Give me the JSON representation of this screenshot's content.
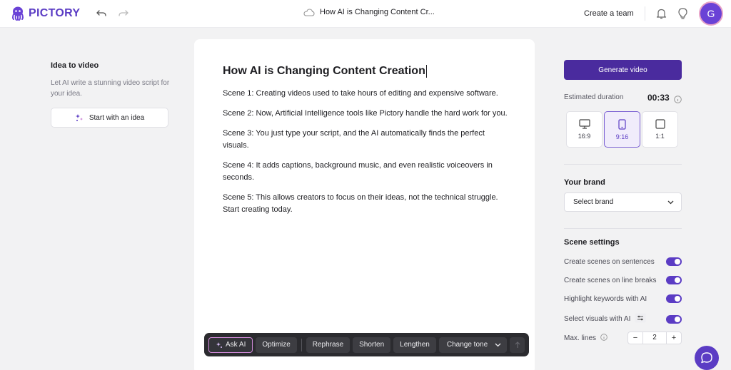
{
  "brand": {
    "name": "PICTORY",
    "accent": "#5b3cc4"
  },
  "header": {
    "doc_title": "How AI is Changing Content Cr...",
    "create_team": "Create a team",
    "avatar_initial": "G"
  },
  "left_panel": {
    "title": "Idea to video",
    "description": "Let AI write a stunning video script for your idea.",
    "start_button": "Start with an idea"
  },
  "editor": {
    "title": "How AI is Changing Content Creation",
    "scenes": [
      "Scene 1: Creating videos used to take hours of editing and expensive software.",
      "Scene 2: Now, Artificial Intelligence tools like Pictory handle the hard work for you.",
      "Scene 3: You just type your script, and the AI automatically finds the perfect visuals.",
      "Scene 4: It adds captions, background music, and even realistic voiceovers in seconds.",
      "Scene 5: This allows creators to focus on their ideas, not the technical struggle. Start creating today."
    ]
  },
  "ai_toolbar": {
    "ask_ai": "Ask AI",
    "optimize": "Optimize",
    "rephrase": "Rephrase",
    "shorten": "Shorten",
    "lengthen": "Lengthen",
    "change_tone": "Change tone"
  },
  "right_panel": {
    "generate_button": "Generate video",
    "duration_label": "Estimated duration",
    "duration_value": "00:33",
    "ratios": [
      {
        "label": "16:9",
        "icon": "monitor-icon",
        "selected": false
      },
      {
        "label": "9:16",
        "icon": "phone-icon",
        "selected": true
      },
      {
        "label": "1:1",
        "icon": "square-icon",
        "selected": false
      }
    ],
    "brand_title": "Your brand",
    "brand_select": "Select brand",
    "scene_settings_title": "Scene settings",
    "settings": [
      {
        "label": "Create scenes on sentences",
        "on": true
      },
      {
        "label": "Create scenes on line breaks",
        "on": true
      },
      {
        "label": "Highlight keywords with AI",
        "on": true
      },
      {
        "label": "Select visuals with AI",
        "on": true
      }
    ],
    "max_lines_label": "Max. lines",
    "max_lines_value": "2"
  }
}
